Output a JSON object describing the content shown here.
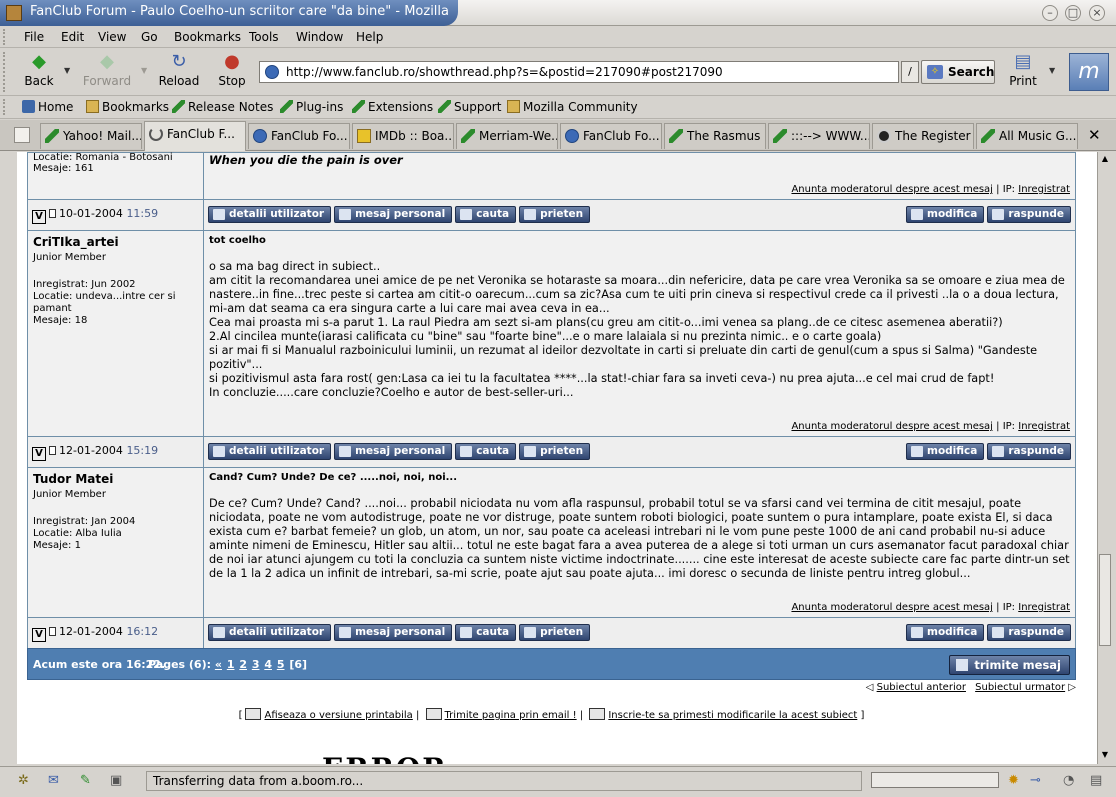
{
  "window": {
    "title": "FanClub Forum - Paulo Coelho-un scriitor care \"da bine\" - Mozilla",
    "controls": [
      "minimize",
      "maximize",
      "close"
    ]
  },
  "menu": [
    "File",
    "Edit",
    "View",
    "Go",
    "Bookmarks",
    "Tools",
    "Window",
    "Help"
  ],
  "toolbar": {
    "back": "Back",
    "forward": "Forward",
    "reload": "Reload",
    "stop": "Stop",
    "url": "http://www.fanclub.ro/showthread.php?s=&postid=217090#post217090",
    "search": "Search",
    "print": "Print"
  },
  "personal_toolbar": [
    "Home",
    "Bookmarks",
    "Release Notes",
    "Plug-ins",
    "Extensions",
    "Support",
    "Mozilla Community"
  ],
  "tabs": [
    "Yahoo! Mail...",
    "FanClub F...",
    "FanClub Fo...",
    "IMDb :: Boa...",
    "Merriam-We...",
    "FanClub Fo...",
    "The Rasmus",
    ":::--> WWW....",
    "The Register",
    "All Music G..."
  ],
  "forum": {
    "report_link": "Anunta moderatorul despre acest mesaj",
    "ip_label": "IP:",
    "ip_value": "Inregistrat",
    "buttons": {
      "profile": "detalii utilizator",
      "pm": "mesaj personal",
      "search": "cauta",
      "buddy": "prieten",
      "edit": "modifica",
      "reply": "raspunde"
    },
    "top_post": {
      "author_info_partial": "Locatie: Romania - Botosani",
      "posts": "Mesaje: 161",
      "text_partial": "When you die the pain is over",
      "date": "10-01-2004",
      "time": "11:59"
    },
    "posts": [
      {
        "username": "CriTIka_artei",
        "usertitle": "Junior Member",
        "registered": "Inregistrat: Jun 2002",
        "location": "Locatie: undeva...intre cer si pamant",
        "count": "Mesaje: 18",
        "title": "tot coelho",
        "body": [
          "o sa ma bag direct in subiect..",
          "am citit la recomandarea unei amice de pe net Veronika se hotaraste sa moara...din nefericire, data pe care vrea Veronika sa se omoare e ziua mea de nastere..in fine...trec peste si cartea am citit-o oarecum...cum sa zic?Asa cum te uiti prin cineva si respectivul crede ca il privesti ..la o a doua lectura, mi-am dat seama ca era singura carte a lui care mai avea ceva in ea...",
          "Cea mai proasta mi s-a parut 1. La raul Piedra am sezt si-am plans(cu greu am citit-o...imi venea sa plang..de ce citesc asemenea aberatii?)",
          "2.Al cincilea munte(iarasi calificata cu \"bine\" sau \"foarte bine\"...e o mare lalaiala si nu prezinta nimic.. e o carte goala)",
          "si ar mai fi si Manualul razboinicului luminii, un rezumat al ideilor dezvoltate in carti si preluate din carti de genul(cum a spus si Salma) \"Gandeste pozitiv\"...",
          "si pozitivismul asta fara rost( gen:Lasa ca iei tu la facultatea ****...la stat!-chiar fara sa inveti ceva-) nu prea ajuta...e cel mai crud de fapt!",
          "In concluzie.....care concluzie?Coelho e autor de best-seller-uri..."
        ],
        "date": "12-01-2004",
        "time": "15:19"
      },
      {
        "username": "Tudor Matei",
        "usertitle": "Junior Member",
        "registered": "Inregistrat: Jan 2004",
        "location": "Locatie: Alba Iulia",
        "count": "Mesaje: 1",
        "title": "Cand? Cum? Unde? De ce? .....noi, noi, noi...",
        "body": [
          "De ce? Cum? Unde? Cand? ....noi... probabil niciodata nu vom afla raspunsul, probabil totul se va sfarsi cand vei termina de citit mesajul, poate niciodata, poate ne vom autodistruge, poate ne vor distruge, poate suntem roboti biologici, poate suntem o pura intamplare, poate exista El, si daca exista cum e? barbat femeie? un glob, un atom, un nor, sau poate ca aceleasi intrebari ni le vom pune peste 1000 de ani cand probabil nu-si aduce aminte nimeni de Eminescu, Hitler sau altii... totul ne este bagat fara a avea puterea de a alege si toti urman un curs asemanator facut paradoxal chiar de noi iar atunci ajungem cu toti la concluzia ca suntem niste victime indoctrinate....... cine este interesat de aceste subiecte care fac parte dintr-un set de la 1 la 2 adica un infinit de intrebari, sa-mi scrie, poate ajut sau poate ajuta... imi doresc o secunda de liniste pentru intreg globul..."
        ],
        "date": "12-01-2004",
        "time": "16:12"
      }
    ],
    "footer": {
      "now": "Acum este ora 16:22.",
      "pages_label": "Pages (6):",
      "first": "«",
      "pages": [
        "1",
        "2",
        "3",
        "4",
        "5"
      ],
      "current": "[6]",
      "new_post": "trimite mesaj"
    },
    "prev_thread": "Subiectul anterior",
    "next_thread": "Subiectul urmator",
    "tools": [
      "Afiseaza o versiune printabila",
      "Trimite pagina prin email !",
      "Inscrie-te sa primesti modificarile la acest subiect"
    ],
    "partial_heading": "ERROR"
  },
  "status": {
    "text": "Transferring data from a.boom.ro..."
  }
}
